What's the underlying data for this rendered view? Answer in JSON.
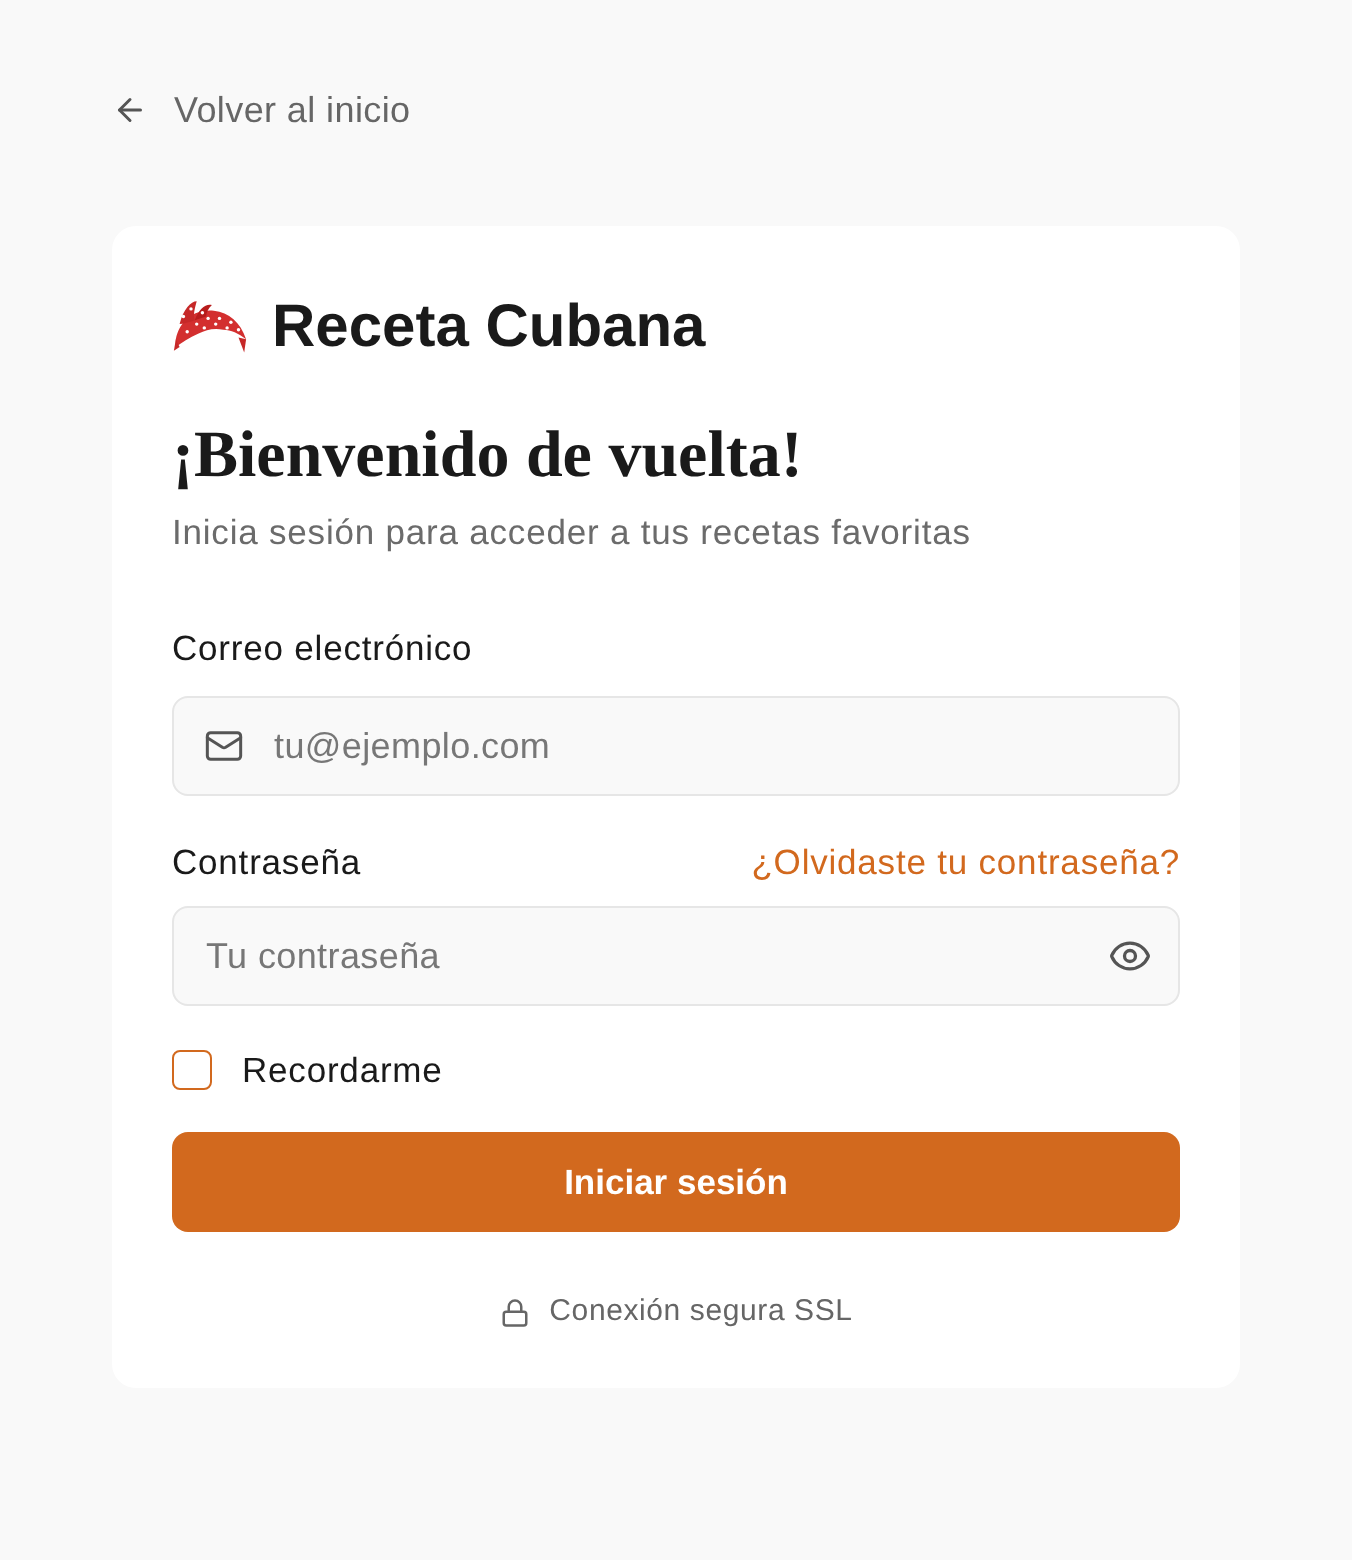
{
  "back_link": {
    "label": "Volver al inicio"
  },
  "brand": {
    "name": "Receta Cubana"
  },
  "heading": "¡Bienvenido de vuelta!",
  "subtitle": "Inicia sesión para acceder a tus recetas favoritas",
  "fields": [
    {
      "kind": "email",
      "label": "Correo electrónico",
      "placeholder": "tu@ejemplo.com"
    },
    {
      "kind": "password",
      "label": "Contraseña",
      "link": "¿Olvidaste tu contraseña?",
      "placeholder": "Tu contraseña"
    }
  ],
  "remember": {
    "label": "Recordarme",
    "checked": false
  },
  "submit": {
    "label": "Iniciar sesión"
  },
  "footer_note": "Conexión segura SSL"
}
